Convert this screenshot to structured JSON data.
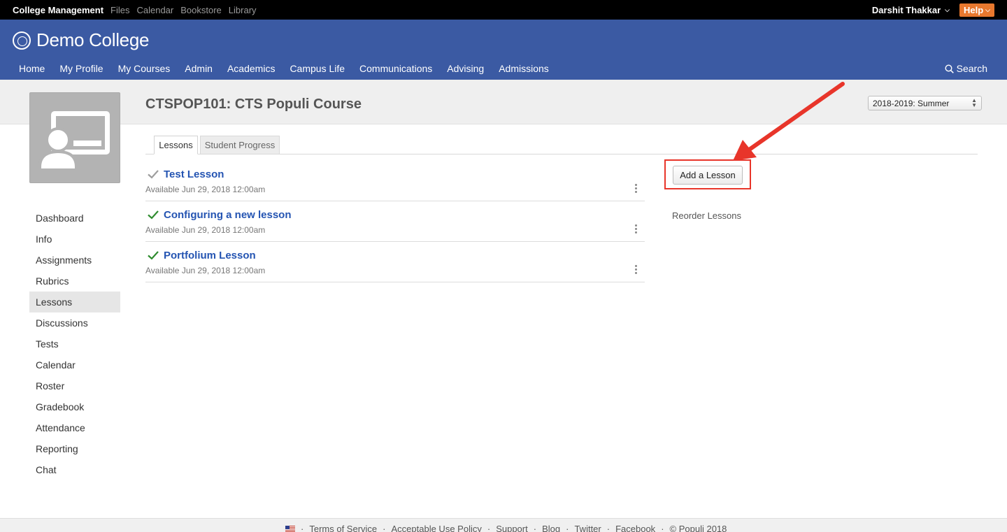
{
  "topbar": {
    "apps": [
      "College Management",
      "Files",
      "Calendar",
      "Bookstore",
      "Library"
    ],
    "user_name": "Darshit Thakkar",
    "help_label": "Help"
  },
  "header": {
    "college_name": "Demo College",
    "nav": [
      "Home",
      "My Profile",
      "My Courses",
      "Admin",
      "Academics",
      "Campus Life",
      "Communications",
      "Advising",
      "Admissions"
    ],
    "search_label": "Search"
  },
  "course": {
    "title": "CTSPOP101: CTS Populi Course",
    "term": "2018-2019: Summer"
  },
  "sidebar": {
    "items": [
      "Dashboard",
      "Info",
      "Assignments",
      "Rubrics",
      "Lessons",
      "Discussions",
      "Tests",
      "Calendar",
      "Roster",
      "Gradebook",
      "Attendance",
      "Reporting",
      "Chat"
    ],
    "active": "Lessons"
  },
  "tabs": {
    "lessons": "Lessons",
    "student_progress": "Student Progress"
  },
  "lessons": [
    {
      "title": "Test Lesson",
      "available": "Available Jun 29, 2018 12:00am",
      "check_color": "#9e9e9e"
    },
    {
      "title": "Configuring a new lesson",
      "available": "Available Jun 29, 2018 12:00am",
      "check_color": "#2e8b2e"
    },
    {
      "title": "Portfolium Lesson",
      "available": "Available Jun 29, 2018 12:00am",
      "check_color": "#2e8b2e"
    }
  ],
  "actions": {
    "add_lesson": "Add a Lesson",
    "reorder_lessons": "Reorder Lessons"
  },
  "footer": {
    "links": [
      "Terms of Service",
      "Acceptable Use Policy",
      "Support",
      "Blog",
      "Twitter",
      "Facebook",
      "© Populi 2018"
    ]
  },
  "colors": {
    "header_blue": "#3b5aa3",
    "help_orange": "#e8782e",
    "link_blue": "#2454b2",
    "annotation_red": "#e8352a"
  }
}
